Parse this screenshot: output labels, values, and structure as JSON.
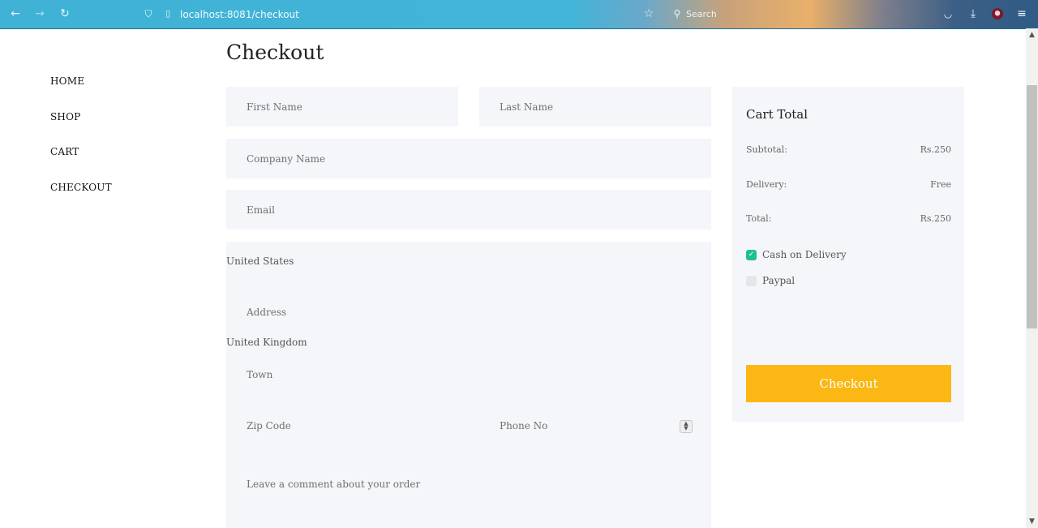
{
  "browser": {
    "url": "localhost:8081/checkout",
    "search_placeholder": "Search"
  },
  "nav": {
    "items": [
      "HOME",
      "SHOP",
      "CART",
      "CHECKOUT"
    ]
  },
  "page": {
    "title": "Checkout"
  },
  "form": {
    "first_name_placeholder": "First Name",
    "last_name_placeholder": "Last Name",
    "company_placeholder": "Company Name",
    "email_placeholder": "Email",
    "country_options": [
      "United States",
      "United Kingdom"
    ],
    "address_placeholder": "Address",
    "town_placeholder": "Town",
    "zip_placeholder": "Zip Code",
    "phone_placeholder": "Phone No",
    "comment_placeholder": "Leave a comment about your order"
  },
  "cart": {
    "title": "Cart Total",
    "subtotal_label": "Subtotal:",
    "subtotal_value": "Rs.250",
    "delivery_label": "Delivery:",
    "delivery_value": "Free",
    "total_label": "Total:",
    "total_value": "Rs.250",
    "payment_options": [
      {
        "label": "Cash on Delivery",
        "checked": true
      },
      {
        "label": "Paypal",
        "checked": false
      }
    ],
    "checkout_label": "Checkout"
  },
  "colors": {
    "accent": "#fbb713",
    "check": "#1fbf8f",
    "field_bg": "#f5f6fa"
  }
}
